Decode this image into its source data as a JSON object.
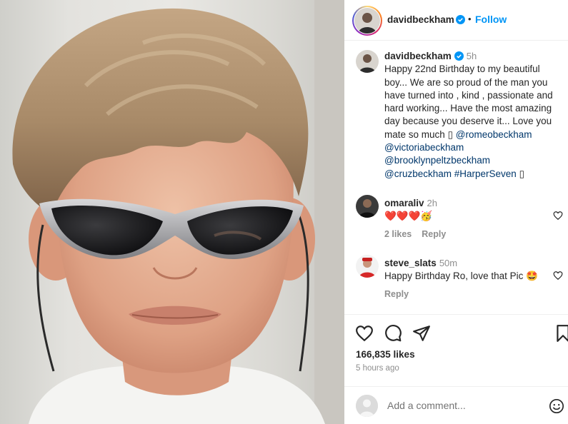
{
  "post": {
    "author": "davidbeckham",
    "follow_label": "Follow",
    "separator": "•",
    "photo_alt": "Boy with light brown hair wearing wraparound sunglasses"
  },
  "caption": {
    "username": "davidbeckham",
    "time": "5h",
    "text": "Happy 22nd Birthday to my beautiful boy... We are so proud of the man you have turned into , kind , passionate and hard working... Have the most amazing day because you deserve it... Love you mate so much",
    "glyph_1": "▯",
    "mentions": [
      "@romeobeckham",
      "@victoriabeckham",
      "@brooklynpeltzbeckham",
      "@cruzbeckham",
      "#HarperSeven"
    ],
    "glyph_2": "▯"
  },
  "comments": [
    {
      "username": "omaraliv",
      "time": "2h",
      "text": "❤️❤️❤️🥳",
      "likes": "2 likes",
      "reply": "Reply"
    },
    {
      "username": "steve_slats",
      "time": "50m",
      "text": "Happy Birthday Ro, love that Pic 🤩",
      "reply": "Reply"
    }
  ],
  "actions": {
    "likes": "166,835 likes",
    "time_ago": "5 hours ago",
    "add_comment_placeholder": "Add a comment..."
  },
  "colors": {
    "link": "#00376b",
    "follow": "#0095f6",
    "muted": "#8e8e8e",
    "heart_red": "#e0245e"
  },
  "icons": [
    "verified-badge-icon",
    "heart-icon",
    "comment-icon",
    "share-icon",
    "bookmark-icon",
    "emoji-icon"
  ]
}
